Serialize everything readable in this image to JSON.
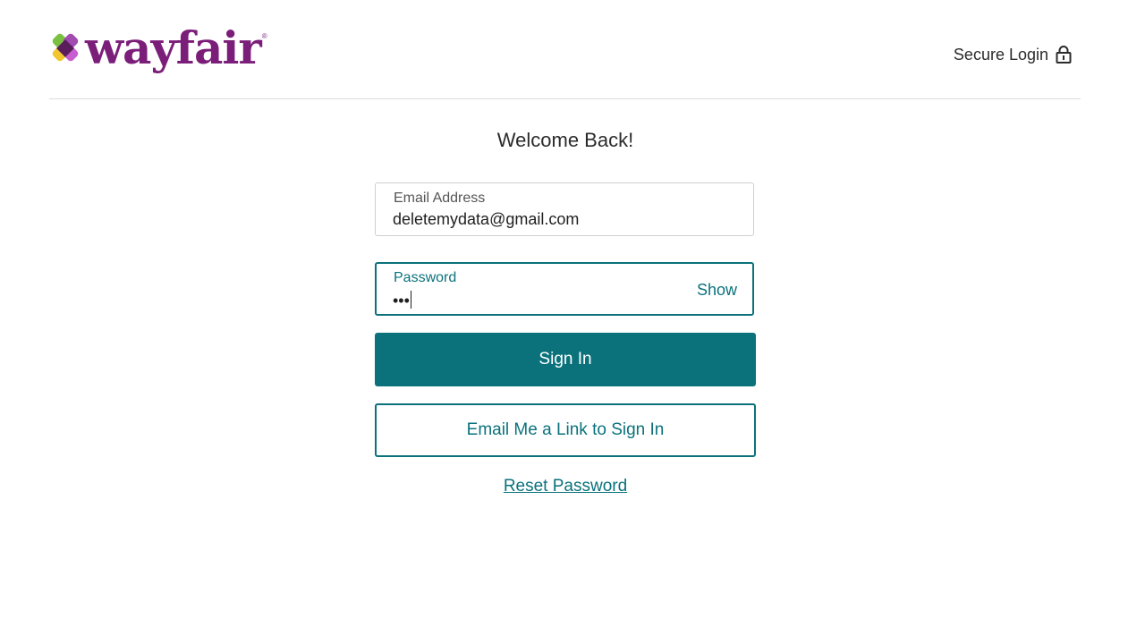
{
  "header": {
    "logo_text": "wayfair",
    "logo_tm": "®",
    "secure_login_label": "Secure Login",
    "secure_icon": "lock-icon"
  },
  "main": {
    "title": "Welcome Back!",
    "email": {
      "label": "Email Address",
      "value": "deletemydata@gmail.com"
    },
    "password": {
      "label": "Password",
      "value_masked": "•••",
      "show_label": "Show"
    },
    "sign_in_label": "Sign In",
    "email_link_label": "Email Me a Link to Sign In",
    "reset_password_label": "Reset Password"
  },
  "colors": {
    "brand_purple": "#7b1e7a",
    "accent_teal": "#0b727c",
    "logo_green": "#7ac142",
    "logo_yellow": "#f2c62f",
    "logo_pink": "#c85fd0"
  }
}
